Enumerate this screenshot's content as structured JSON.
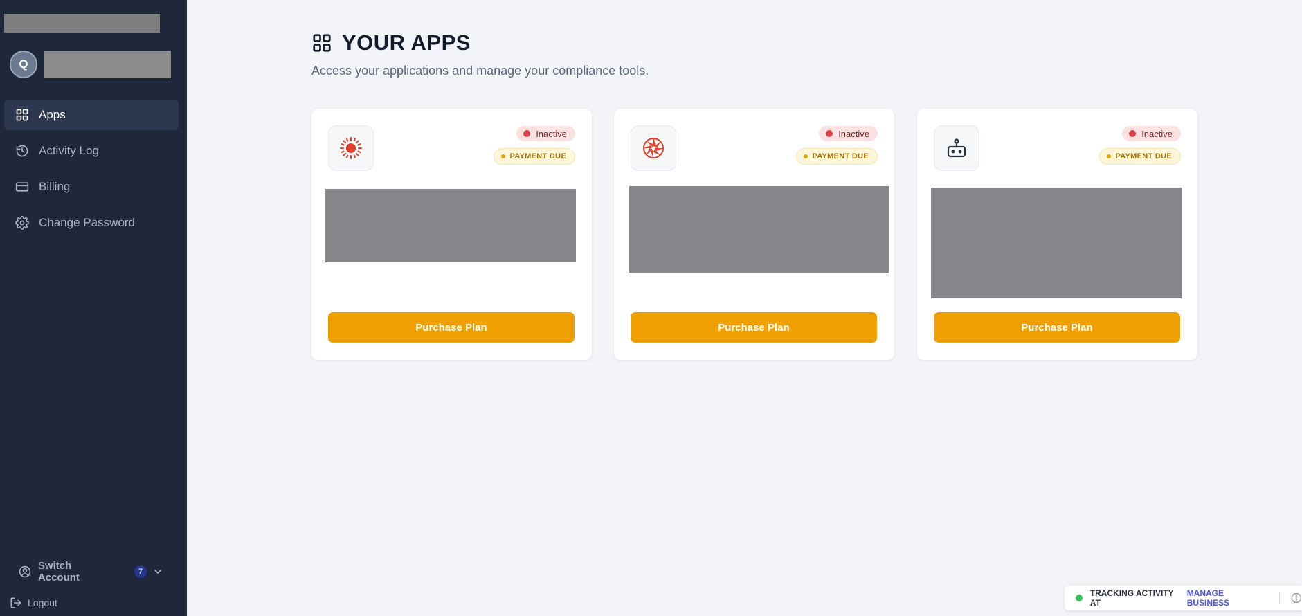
{
  "sidebar": {
    "avatar_initial": "Q",
    "nav": [
      {
        "label": "Apps",
        "icon": "grid-icon",
        "active": true
      },
      {
        "label": "Activity Log",
        "icon": "history-icon",
        "active": false
      },
      {
        "label": "Billing",
        "icon": "credit-card-icon",
        "active": false
      },
      {
        "label": "Change Password",
        "icon": "gear-icon",
        "active": false
      }
    ],
    "switch_account": {
      "label": "Switch Account",
      "count": "7"
    },
    "logout": "Logout"
  },
  "main": {
    "title": "YOUR APPS",
    "subtitle": "Access your applications and manage your compliance tools."
  },
  "apps": [
    {
      "icon": "sun-icon",
      "status": "Inactive",
      "payment": "PAYMENT DUE",
      "button": "Purchase Plan"
    },
    {
      "icon": "aperture-icon",
      "status": "Inactive",
      "payment": "PAYMENT DUE",
      "button": "Purchase Plan"
    },
    {
      "icon": "robot-icon",
      "status": "Inactive",
      "payment": "PAYMENT DUE",
      "button": "Purchase Plan"
    }
  ],
  "tracker": {
    "prefix": "TRACKING ACTIVITY AT",
    "link": "MANAGE BUSINESS"
  },
  "colors": {
    "sidebar_bg": "#1f283b",
    "accent": "#ef9f00",
    "inactive": "#dc3f3f",
    "link": "#4f55e3"
  }
}
